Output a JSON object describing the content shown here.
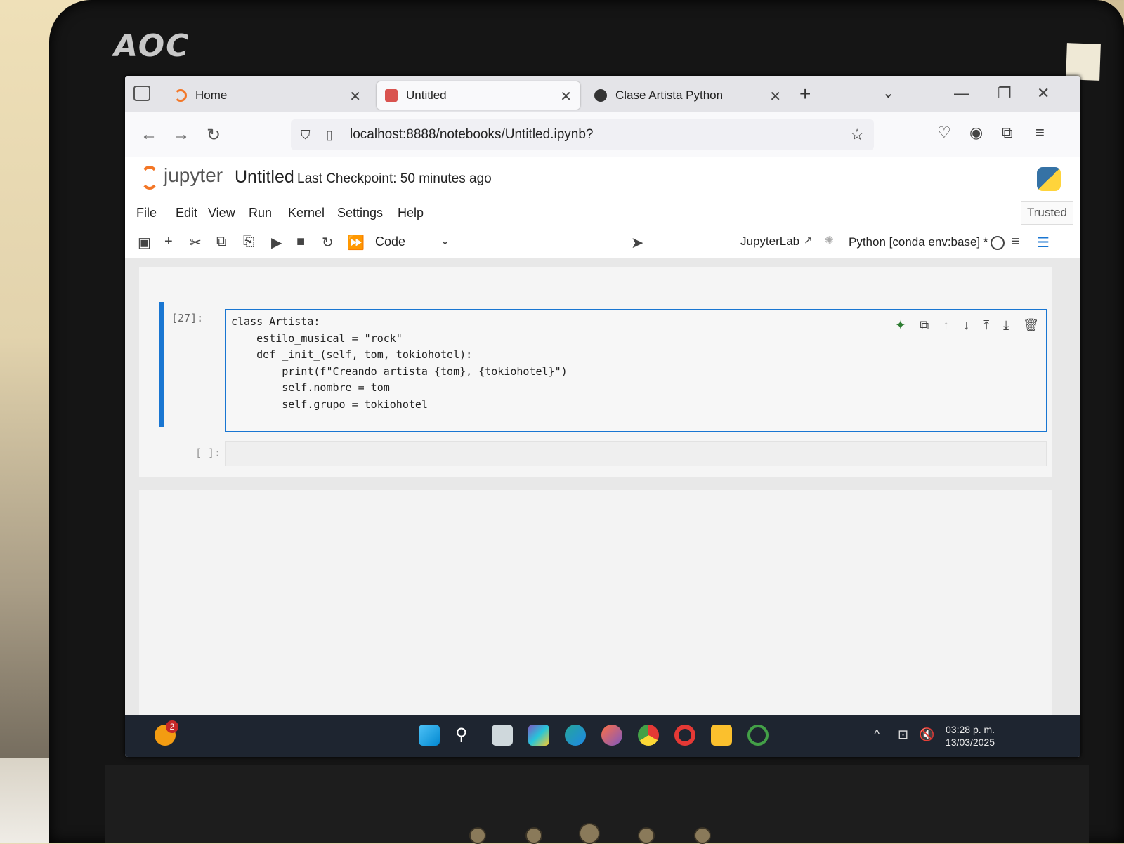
{
  "monitor": {
    "brand": "AOC"
  },
  "browser": {
    "tabs": [
      {
        "label": "Home",
        "active": false
      },
      {
        "label": "Untitled",
        "active": true
      },
      {
        "label": "Clase Artista Python",
        "active": false
      }
    ],
    "url": "localhost:8888/notebooks/Untitled.ipynb?"
  },
  "jupyter": {
    "app_name": "jupyter",
    "notebook_title": "Untitled",
    "checkpoint": "Last Checkpoint: 50 minutes ago",
    "menu": [
      "File",
      "Edit",
      "View",
      "Run",
      "Kernel",
      "Settings",
      "Help"
    ],
    "trusted": "Trusted",
    "cell_type": "Code",
    "jupyterlab_link": "JupyterLab",
    "kernel": "Python [conda env:base] *",
    "cells": [
      {
        "prompt": "[27]:",
        "code_lines": [
          "class Artista:",
          "    estilo_musical = \"rock\"",
          "    def _init_(self, tom, tokiohotel):",
          "        print(f\"Creando artista {tom}, {tokiohotel}\")",
          "        self.nombre = tom",
          "        self.grupo = tokiohotel"
        ]
      },
      {
        "prompt": "[ ]:"
      }
    ]
  },
  "taskbar": {
    "notification_count": "2",
    "time": "03:28 p. m.",
    "date": "13/03/2025"
  }
}
